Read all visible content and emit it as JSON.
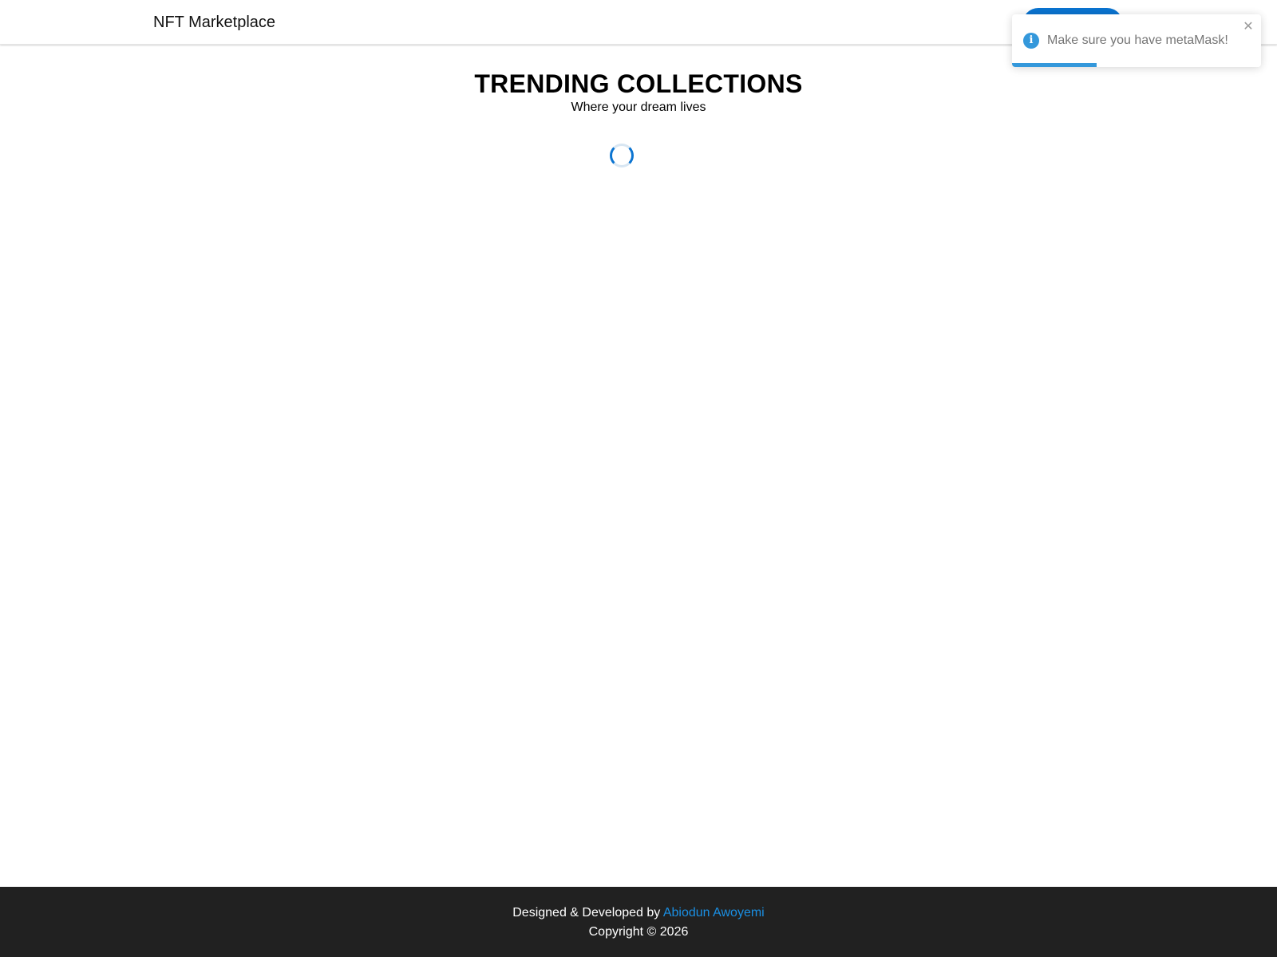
{
  "header": {
    "brand": "NFT Marketplace",
    "connect_button_label": ""
  },
  "hero": {
    "title": "TRENDING COLLECTIONS",
    "subtitle": "Where your dream lives"
  },
  "toast": {
    "message": "Make sure you have metaMask!",
    "icon": "info-icon",
    "close_glyph": "✕",
    "progress_fraction": 0.34,
    "color": "#3498db"
  },
  "footer": {
    "credit_prefix": "Designed & Developed by",
    "author_name": "Abiodun Awoyemi",
    "copyright": "Copyright © 2026"
  },
  "colors": {
    "accent": "#0b74d1",
    "footer_bg": "#212121",
    "link": "#1a8fe3"
  }
}
